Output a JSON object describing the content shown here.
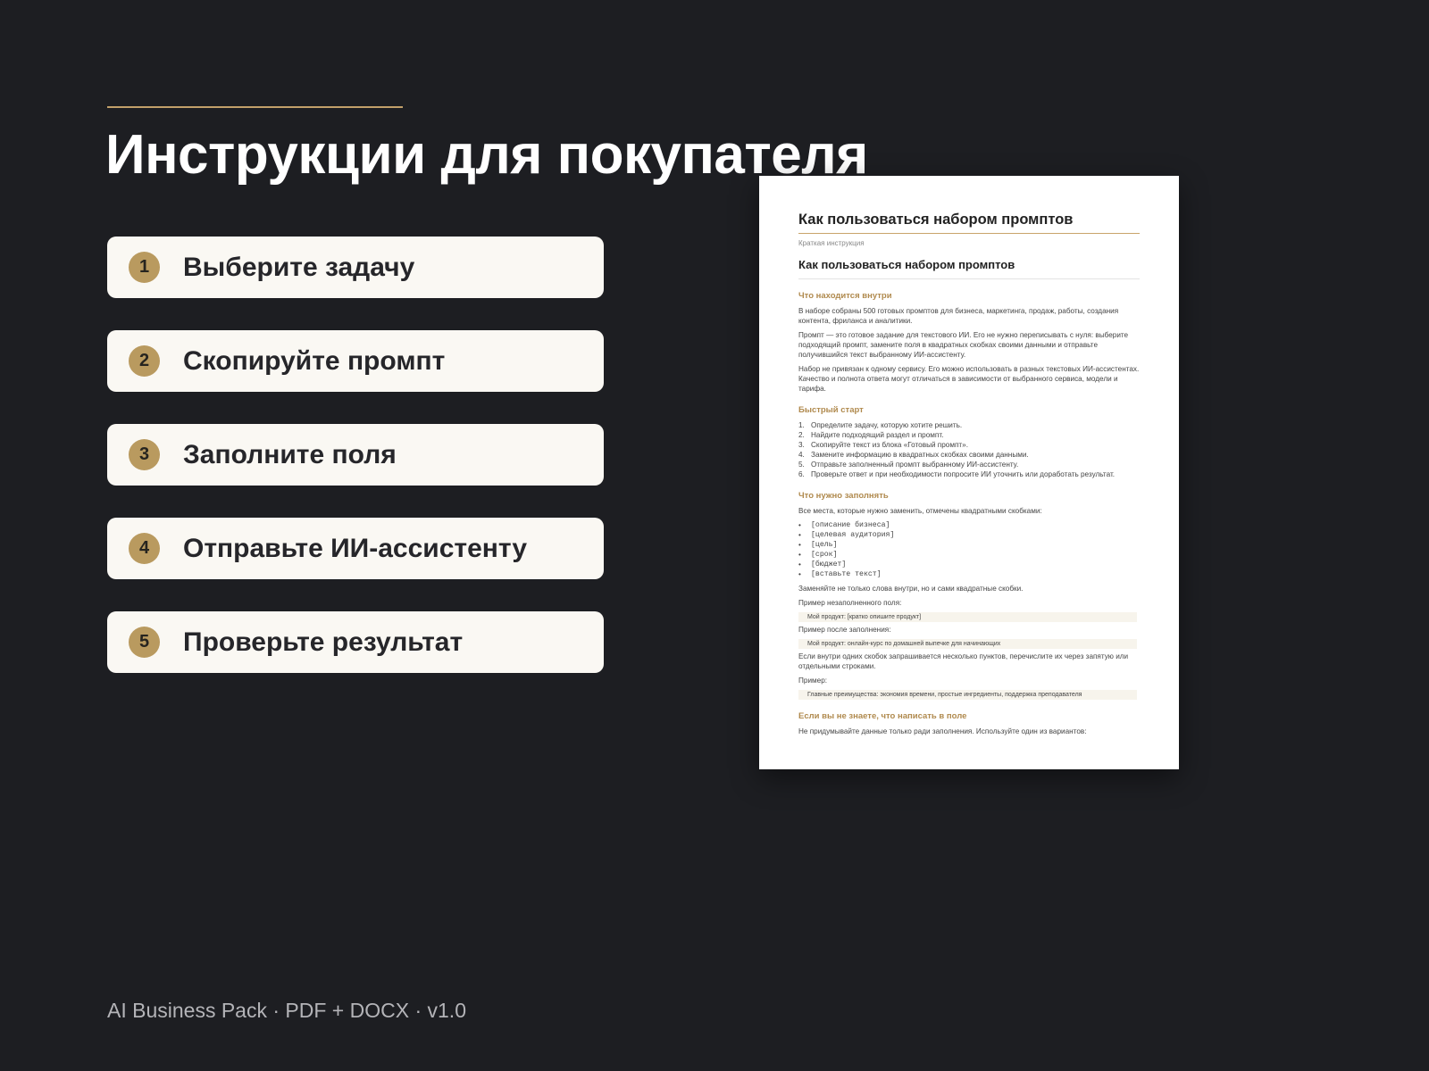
{
  "header": {
    "title": "Инструкции для покупателя"
  },
  "steps": [
    {
      "number": "1",
      "label": "Выберите задачу"
    },
    {
      "number": "2",
      "label": "Скопируйте промпт"
    },
    {
      "number": "3",
      "label": "Заполните поля"
    },
    {
      "number": "4",
      "label": "Отправьте ИИ-ассистенту"
    },
    {
      "number": "5",
      "label": "Проверьте результат"
    }
  ],
  "document": {
    "title": "Как пользоваться набором промптов",
    "subtitle": "Краткая инструкция",
    "heading": "Как пользоваться набором промптов",
    "section1": {
      "title": "Что находится внутри",
      "p1": "В наборе собраны 500 готовых промптов для бизнеса, маркетинга, продаж, работы, создания контента, фриланса и аналитики.",
      "p2": "Промпт — это готовое задание для текстового ИИ. Его не нужно переписывать с нуля: выберите подходящий промпт, замените поля в квадратных скобках своими данными и отправьте получившийся текст выбранному ИИ-ассистенту.",
      "p3": "Набор не привязан к одному сервису. Его можно использовать в разных текстовых ИИ-ассистентах. Качество и полнота ответа могут отличаться в зависимости от выбранного сервиса, модели и тарифа."
    },
    "section2": {
      "title": "Быстрый старт",
      "items": [
        {
          "num": "1.",
          "text": "Определите задачу, которую хотите решить."
        },
        {
          "num": "2.",
          "text": "Найдите подходящий раздел и промпт."
        },
        {
          "num": "3.",
          "text": "Скопируйте текст из блока «Готовый промпт»."
        },
        {
          "num": "4.",
          "text": "Замените информацию в квадратных скобках своими данными."
        },
        {
          "num": "5.",
          "text": "Отправьте заполненный промпт выбранному ИИ-ассистенту."
        },
        {
          "num": "6.",
          "text": "Проверьте ответ и при необходимости попросите ИИ уточнить или доработать результат."
        }
      ]
    },
    "section3": {
      "title": "Что нужно заполнять",
      "intro": "Все места, которые нужно заменить, отмечены квадратными скобками:",
      "bullets": [
        "[описание бизнеса]",
        "[целевая аудитория]",
        "[цель]",
        "[срок]",
        "[бюджет]",
        "[вставьте текст]"
      ],
      "note": "Заменяйте не только слова внутри, но и сами квадратные скобки.",
      "example_before_label": "Пример незаполненного поля:",
      "example_before": "Мой продукт: [кратко опишите продукт]",
      "example_after_label": "Пример после заполнения:",
      "example_after": "Мой продукт: онлайн-курс по домашней выпечке для начинающих",
      "multi_note": "Если внутри одних скобок запрашивается несколько пунктов, перечислите их через запятую или отдельными строками.",
      "example_label": "Пример:",
      "example": "Главные преимущества: экономия времени, простые ингредиенты, поддержка преподавателя"
    },
    "section4": {
      "title": "Если вы не знаете, что написать в поле",
      "p1": "Не придумывайте данные только ради заполнения. Используйте один из вариантов:"
    },
    "bullet_char": "•"
  },
  "footer": {
    "text": "AI Business Pack · PDF + DOCX · v1.0"
  },
  "colors": {
    "background": "#1d1e22",
    "accent": "#c2a06a",
    "card": "#faf8f3",
    "badge": "#b99a5f",
    "section_heading": "#b08a4e"
  }
}
